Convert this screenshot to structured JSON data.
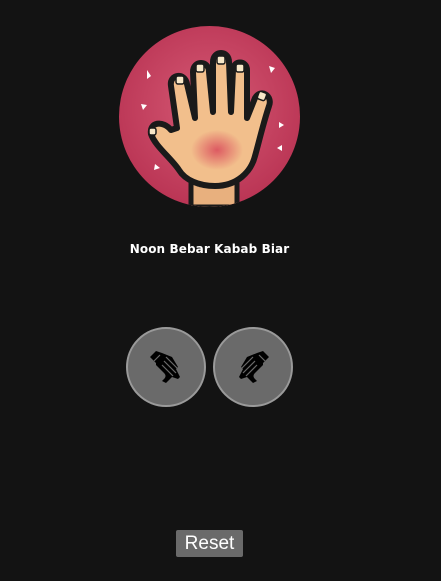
{
  "player_name": "Noon Bebar Kabab Biar",
  "avatar": {
    "icon": "slapping-hand-icon",
    "background_color": "#c8435f"
  },
  "controls": {
    "left_icon": "left-slap-hand-icon",
    "right_icon": "right-slap-hand-icon"
  },
  "reset_label": "Reset"
}
